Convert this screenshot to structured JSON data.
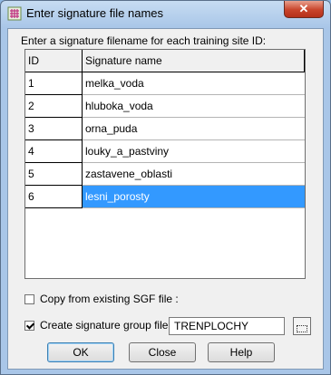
{
  "window": {
    "title": "Enter signature file names",
    "close_label": "✕"
  },
  "instruction": "Enter a signature filename for each training site ID:",
  "table": {
    "columns": [
      "ID",
      "Signature name"
    ],
    "rows": [
      {
        "id": "1",
        "name": "melka_voda"
      },
      {
        "id": "2",
        "name": "hluboka_voda"
      },
      {
        "id": "3",
        "name": "orna_puda"
      },
      {
        "id": "4",
        "name": "louky_a_pastviny"
      },
      {
        "id": "5",
        "name": "zastavene_oblasti"
      },
      {
        "id": "6",
        "name": "lesni_porosty"
      }
    ],
    "selected_row": 5
  },
  "copy_sgf": {
    "label": "Copy from existing SGF file :",
    "checked": false
  },
  "create_group": {
    "label": "Create signature group file :",
    "checked": true,
    "value": "TRENPLOCHY"
  },
  "buttons": {
    "ok": "OK",
    "close": "Close",
    "help": "Help"
  },
  "colors": {
    "selection": "#3399ff",
    "close_button": "#c8442b"
  }
}
